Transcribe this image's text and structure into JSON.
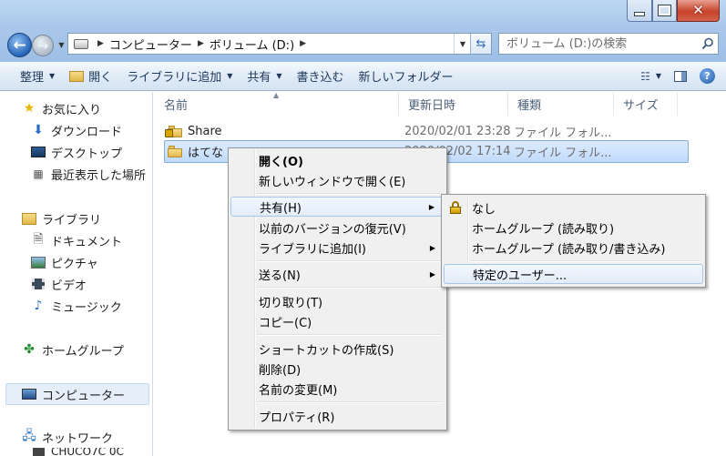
{
  "address": {
    "crumbs": [
      "コンピューター",
      "ボリューム (D:)"
    ]
  },
  "search": {
    "placeholder": "ボリューム (D:)の検索"
  },
  "commands": [
    {
      "label": "整理",
      "dropdown": true
    },
    {
      "label": "開く",
      "dropdown": false
    },
    {
      "label": "ライブラリに追加",
      "dropdown": true
    },
    {
      "label": "共有",
      "dropdown": true
    },
    {
      "label": "書き込む",
      "dropdown": false
    },
    {
      "label": "新しいフォルダー",
      "dropdown": false
    }
  ],
  "nav": {
    "favorites": "お気に入り",
    "downloads": "ダウンロード",
    "desktop": "デスクトップ",
    "recent": "最近表示した場所",
    "libraries": "ライブラリ",
    "documents": "ドキュメント",
    "pictures": "ピクチャ",
    "videos": "ビデオ",
    "music": "ミュージック",
    "homegroup": "ホームグループ",
    "computer": "コンピューター",
    "network": "ネットワーク",
    "network_child": "CHUCO7C 0C"
  },
  "columns": {
    "name": "名前",
    "date": "更新日時",
    "type": "種類",
    "size": "サイズ"
  },
  "files": [
    {
      "name": "Share",
      "date": "2020/02/01 23:28",
      "type": "ファイル フォル...",
      "shared": true
    },
    {
      "name": "はてな",
      "date": "2020/02/02 17:14",
      "type": "ファイル フォル...",
      "shared": false
    }
  ],
  "context_menu": {
    "open": "開く(O)",
    "open_new_window": "新しいウィンドウで開く(E)",
    "share": "共有(H)",
    "restore_prev": "以前のバージョンの復元(V)",
    "add_to_library": "ライブラリに追加(I)",
    "send_to": "送る(N)",
    "cut": "切り取り(T)",
    "copy": "コピー(C)",
    "create_shortcut": "ショートカットの作成(S)",
    "delete": "削除(D)",
    "rename": "名前の変更(M)",
    "properties": "プロパティ(R)"
  },
  "share_submenu": {
    "nobody": "なし",
    "homegroup_read": "ホームグループ (読み取り)",
    "homegroup_readwrite": "ホームグループ (読み取り/書き込み)",
    "specific_people": "特定のユーザー..."
  },
  "colors": {
    "accent": "#2563b8",
    "selection": "#c1dbfc",
    "close": "#c7432a"
  }
}
